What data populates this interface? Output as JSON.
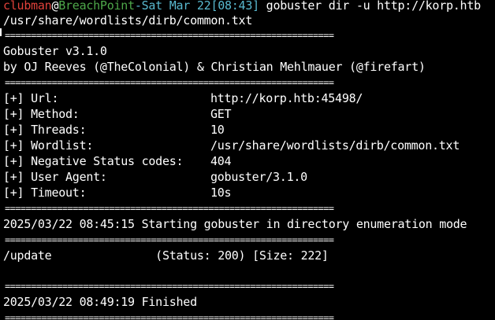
{
  "prompt": {
    "user": "clubman",
    "at": "@",
    "host": "BreachPoint",
    "dash": "-",
    "date": "Sat Mar 22",
    "time": "[08:43]",
    "command": " gobuster dir -u http://korp.htb",
    "command_cont": "/usr/share/wordlists/dirb/common.txt"
  },
  "separator": "===============================================================",
  "banner": {
    "title": "Gobuster v3.1.0",
    "authors": "by OJ Reeves (@TheColonial) & Christian Mehlmauer (@firefart)"
  },
  "config": [
    {
      "label": "[+] Url:",
      "value": "http://korp.htb:45498/"
    },
    {
      "label": "[+] Method:",
      "value": "GET"
    },
    {
      "label": "[+] Threads:",
      "value": "10"
    },
    {
      "label": "[+] Wordlist:",
      "value": "/usr/share/wordlists/dirb/common.txt"
    },
    {
      "label": "[+] Negative Status codes:",
      "value": "404"
    },
    {
      "label": "[+] User Agent:",
      "value": "gobuster/3.1.0"
    },
    {
      "label": "[+] Timeout:",
      "value": "10s"
    }
  ],
  "start_message": "2025/03/22 08:45:15 Starting gobuster in directory enumeration mode",
  "result": "/update               (Status: 200) [Size: 222]",
  "finish_message": "2025/03/22 08:49:19 Finished"
}
